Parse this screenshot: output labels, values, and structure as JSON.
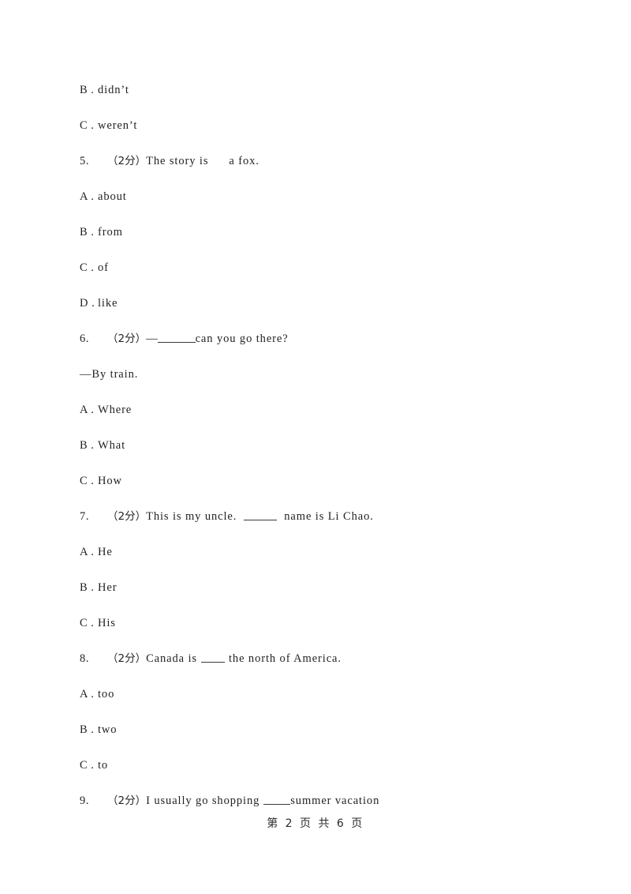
{
  "document": {
    "page_footer": "第 2 页 共 6 页",
    "page_number": "2",
    "total_pages": "6"
  },
  "orphan_options": [
    {
      "label": "B .",
      "text": "didn’t"
    },
    {
      "label": "C .",
      "text": "weren’t"
    }
  ],
  "questions": [
    {
      "number": "5.",
      "score": "（2分）",
      "stem_before": "The story is",
      "blank": "gap",
      "stem_after": "a fox.",
      "options": [
        {
          "label": "A .",
          "text": "about"
        },
        {
          "label": "B .",
          "text": "from"
        },
        {
          "label": "C .",
          "text": "of"
        },
        {
          "label": "D .",
          "text": "like"
        }
      ]
    },
    {
      "number": "6.",
      "score": "（2分）",
      "stem_before": "—",
      "blank": "blank-lg",
      "stem_after": "can you go there?",
      "continuation": "—By train.",
      "options": [
        {
          "label": "A .",
          "text": "Where"
        },
        {
          "label": "B .",
          "text": "What"
        },
        {
          "label": "C .",
          "text": "How"
        }
      ]
    },
    {
      "number": "7.",
      "score": "（2分）",
      "stem_before": "This is my uncle.",
      "blank": "blank-md",
      "stem_after": "name is Li Chao.",
      "options": [
        {
          "label": "A .",
          "text": "He"
        },
        {
          "label": "B .",
          "text": "Her"
        },
        {
          "label": "C .",
          "text": "His"
        }
      ]
    },
    {
      "number": "8.",
      "score": "（2分）",
      "stem_before": "Canada is",
      "blank": "blank-xs",
      "stem_after": "the north of America.",
      "options": [
        {
          "label": "A .",
          "text": "too"
        },
        {
          "label": "B .",
          "text": "two"
        },
        {
          "label": "C .",
          "text": "to"
        }
      ]
    },
    {
      "number": "9.",
      "score": "（2分）",
      "stem_before": "I usually go shopping",
      "blank": "blank-sm",
      "stem_after": "summer vacation",
      "options": []
    }
  ]
}
